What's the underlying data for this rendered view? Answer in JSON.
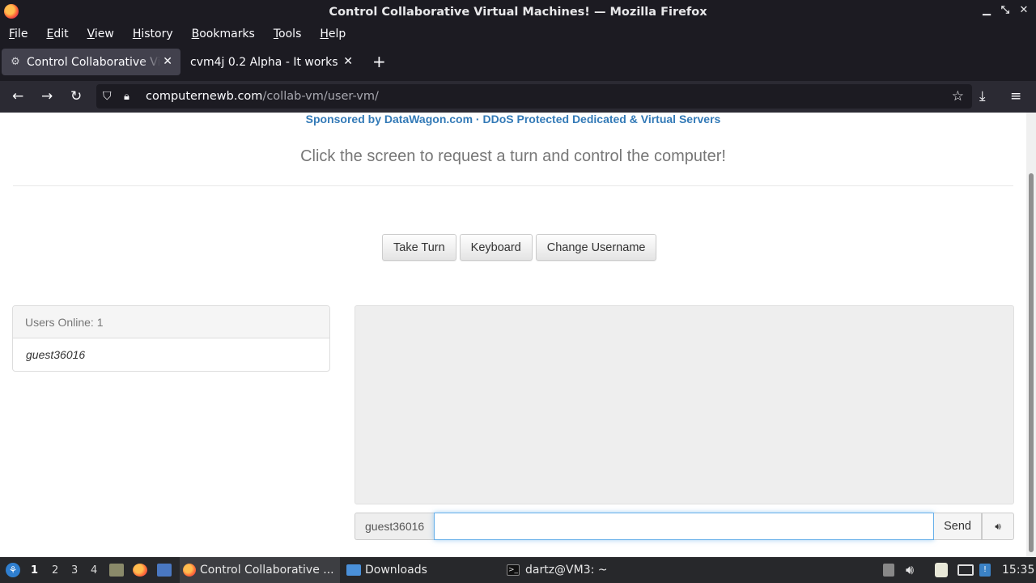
{
  "window": {
    "title": "Control Collaborative Virtual Machines! — Mozilla Firefox"
  },
  "menu": [
    "File",
    "Edit",
    "View",
    "History",
    "Bookmarks",
    "Tools",
    "Help"
  ],
  "tabs": [
    {
      "label": "Control Collaborative Virtual Machines!",
      "active": true
    },
    {
      "label": "cvm4j 0.2 Alpha - It works!",
      "active": false
    }
  ],
  "address": {
    "host": "computernewb.com",
    "path": "/collab-vm/user-vm/"
  },
  "page": {
    "sponsor": "Sponsored by DataWagon.com · DDoS Protected Dedicated & Virtual Servers",
    "headline": "Click the screen to request a turn and control the computer!",
    "buttons": {
      "take_turn": "Take Turn",
      "keyboard": "Keyboard",
      "change_username": "Change Username"
    },
    "users": {
      "header": "Users Online: 1",
      "list": [
        "guest36016"
      ]
    },
    "chat": {
      "username": "guest36016",
      "input_value": "",
      "send": "Send"
    }
  },
  "taskbar": {
    "workspaces": [
      "1",
      "2",
      "3",
      "4"
    ],
    "current_workspace": "1",
    "tasks": [
      {
        "label": "Control Collaborative ...",
        "active": true
      },
      {
        "label": "Downloads",
        "active": false
      },
      {
        "label": "dartz@VM3: ~",
        "active": false
      }
    ],
    "clock": "15:35"
  },
  "colors": {
    "accent_link": "#337ab7",
    "chrome_dark": "#1c1b22",
    "toolbar": "#2b2a33",
    "taskbar": "#27282b"
  }
}
